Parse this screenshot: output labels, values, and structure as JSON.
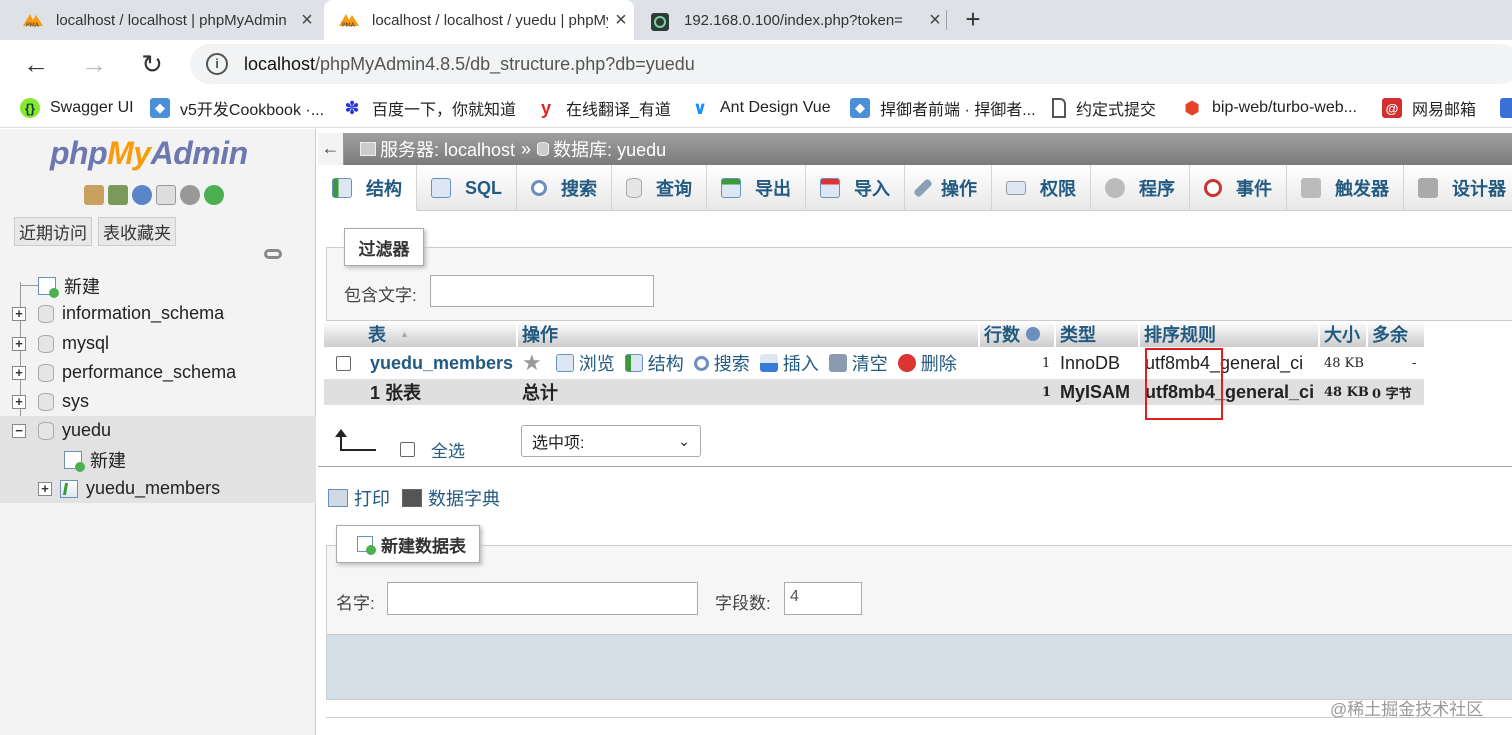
{
  "browser": {
    "tabs": [
      {
        "title": "localhost / localhost | phpMyAdmin",
        "favicon": "phpmyadmin-icon"
      },
      {
        "title": "localhost / localhost / yuedu | phpMyAdmin",
        "favicon": "phpmyadmin-icon"
      },
      {
        "title": "192.168.0.100/index.php?token=",
        "favicon": "globe-icon"
      }
    ],
    "new_tab": "+",
    "address": {
      "host": "localhost",
      "path": "/phpMyAdmin4.8.5/db_structure.php?db=yuedu"
    },
    "bookmarks": [
      {
        "label": "Swagger UI",
        "color": "#85ea2d"
      },
      {
        "label": "v5开发Cookbook ·...",
        "color": "#4a90d9"
      },
      {
        "label": "百度一下，你就知道",
        "color": "#2932e1"
      },
      {
        "label": "在线翻译_有道",
        "color": "#e52222"
      },
      {
        "label": "Ant Design Vue",
        "color": "#1890ff"
      },
      {
        "label": "捍御者前端 · 捍御者...",
        "color": "#4a90d9"
      },
      {
        "label": "约定式提交",
        "color": "#666666"
      },
      {
        "label": "bip-web/turbo-web...",
        "color": "#e24329"
      },
      {
        "label": "网易邮箱",
        "color": "#d32f2f"
      }
    ]
  },
  "nav": {
    "recent": "近期访问",
    "favorites": "表收藏夹",
    "tree": [
      {
        "label": "新建",
        "type": "new"
      },
      {
        "label": "information_schema",
        "type": "db"
      },
      {
        "label": "mysql",
        "type": "db"
      },
      {
        "label": "performance_schema",
        "type": "db"
      },
      {
        "label": "sys",
        "type": "db"
      },
      {
        "label": "yuedu",
        "type": "db"
      },
      {
        "label": "新建",
        "type": "new"
      },
      {
        "label": "yuedu_members",
        "type": "table"
      }
    ]
  },
  "breadcrumb": {
    "server": "服务器: localhost",
    "sep": "»",
    "db": "数据库: yuedu"
  },
  "menu": [
    {
      "label": "结构",
      "icon": "structure-icon"
    },
    {
      "label": "SQL",
      "icon": "sql-icon"
    },
    {
      "label": "搜索",
      "icon": "search-icon"
    },
    {
      "label": "查询",
      "icon": "query-icon"
    },
    {
      "label": "导出",
      "icon": "export-icon"
    },
    {
      "label": "导入",
      "icon": "import-icon"
    },
    {
      "label": "操作",
      "icon": "wrench-icon"
    },
    {
      "label": "权限",
      "icon": "privileges-icon"
    },
    {
      "label": "程序",
      "icon": "routines-icon"
    },
    {
      "label": "事件",
      "icon": "clock-icon"
    },
    {
      "label": "触发器",
      "icon": "triggers-icon"
    },
    {
      "label": "设计器",
      "icon": "designer-icon"
    }
  ],
  "filter": {
    "legend": "过滤器",
    "label": "包含文字:",
    "value": ""
  },
  "table": {
    "headers": {
      "name": "表",
      "sort": "▲",
      "action": "操作",
      "rows": "行数",
      "type": "类型",
      "collation": "排序规则",
      "size": "大小",
      "overhead": "多余"
    },
    "row": {
      "name": "yuedu_members",
      "actions": [
        "浏览",
        "结构",
        "搜索",
        "插入",
        "清空",
        "删除"
      ],
      "rows": "1",
      "type": "InnoDB",
      "collation": "utf8mb4_general_ci",
      "size": "48 KB",
      "overhead": "-"
    },
    "summary": {
      "name": "1 张表",
      "action": "总计",
      "rows": "1",
      "type": "MyISAM",
      "collation": "utf8mb4_general_ci",
      "size": "48 KB",
      "overhead": "0 字节"
    }
  },
  "bulk": {
    "select_all": "全选",
    "with_selected": "选中项:"
  },
  "links": {
    "print": "打印",
    "dictionary": "数据字典"
  },
  "create": {
    "legend": "新建数据表",
    "name_label": "名字:",
    "name_value": "",
    "cols_label": "字段数:",
    "cols_value": "4"
  },
  "watermark": "@稀土掘金技术社区"
}
